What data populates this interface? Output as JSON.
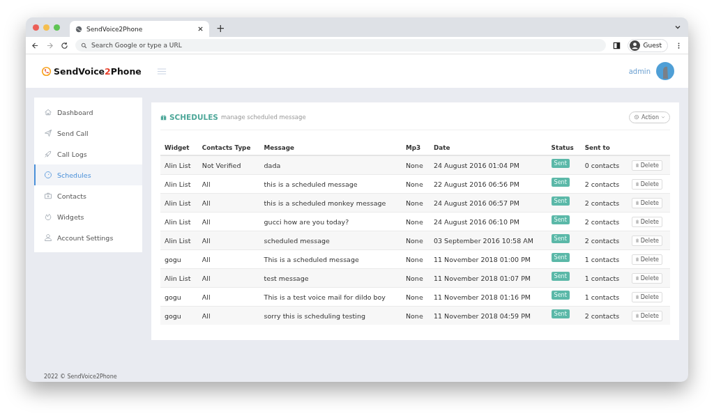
{
  "browser": {
    "tab_title": "SendVoice2Phone",
    "new_tab": "+",
    "address_placeholder": "Search Google or type a URL",
    "profile": "Guest"
  },
  "header": {
    "logo": [
      {
        "text": "SendVoice",
        "accent": false
      },
      {
        "text": "2",
        "accent": true
      },
      {
        "text": "Phone",
        "accent": false
      }
    ],
    "user": "admin"
  },
  "sidebar": {
    "items": [
      {
        "label": "Dashboard",
        "selected": false
      },
      {
        "label": "Send Call",
        "selected": false
      },
      {
        "label": "Call Logs",
        "selected": false
      },
      {
        "label": "Schedules",
        "selected": true
      },
      {
        "label": "Contacts",
        "selected": false
      },
      {
        "label": "Widgets",
        "selected": false
      },
      {
        "label": "Account Settings",
        "selected": false
      }
    ]
  },
  "panel": {
    "title": "SCHEDULES",
    "subtitle": "manage scheduled message",
    "action": "Action"
  },
  "table": {
    "columns": [
      "Widget",
      "Contacts Type",
      "Message",
      "Mp3",
      "Date",
      "Status",
      "Sent to"
    ],
    "rows": [
      {
        "widget": "Alin List",
        "contacts_type": "Not Verified",
        "message": "dada",
        "mp3": "None",
        "date": "24 August 2016 01:04 PM",
        "status": "Sent",
        "sent_to": "0 contacts",
        "action": "Delete"
      },
      {
        "widget": "Alin List",
        "contacts_type": "All",
        "message": "this is a scheduled message",
        "mp3": "None",
        "date": "22 August 2016 06:56 PM",
        "status": "Sent",
        "sent_to": "2 contacts",
        "action": "Delete"
      },
      {
        "widget": "Alin List",
        "contacts_type": "All",
        "message": "this is a scheduled monkey message",
        "mp3": "None",
        "date": "24 August 2016 06:57 PM",
        "status": "Sent",
        "sent_to": "2 contacts",
        "action": "Delete"
      },
      {
        "widget": "Alin List",
        "contacts_type": "All",
        "message": "gucci how are you today?",
        "mp3": "None",
        "date": "24 August 2016 06:10 PM",
        "status": "Sent",
        "sent_to": "2 contacts",
        "action": "Delete"
      },
      {
        "widget": "Alin List",
        "contacts_type": "All",
        "message": "scheduled message",
        "mp3": "None",
        "date": "03 September 2016 10:58 AM",
        "status": "Sent",
        "sent_to": "2 contacts",
        "action": "Delete"
      },
      {
        "widget": "gogu",
        "contacts_type": "All",
        "message": "This is a scheduled message",
        "mp3": "None",
        "date": "11 November 2018 01:00 PM",
        "status": "Sent",
        "sent_to": "1 contacts",
        "action": "Delete"
      },
      {
        "widget": "Alin List",
        "contacts_type": "All",
        "message": "test message",
        "mp3": "None",
        "date": "11 November 2018 01:07 PM",
        "status": "Sent",
        "sent_to": "1 contacts",
        "action": "Delete"
      },
      {
        "widget": "gogu",
        "contacts_type": "All",
        "message": "This is a test voice mail for dildo boy",
        "mp3": "None",
        "date": "11 November 2018 01:16 PM",
        "status": "Sent",
        "sent_to": "1 contacts",
        "action": "Delete"
      },
      {
        "widget": "gogu",
        "contacts_type": "All",
        "message": "sorry this is scheduling testing",
        "mp3": "None",
        "date": "11 November 2018 04:59 PM",
        "status": "Sent",
        "sent_to": "2 contacts",
        "action": "Delete"
      }
    ]
  },
  "footer": "2022 © SendVoice2Phone"
}
